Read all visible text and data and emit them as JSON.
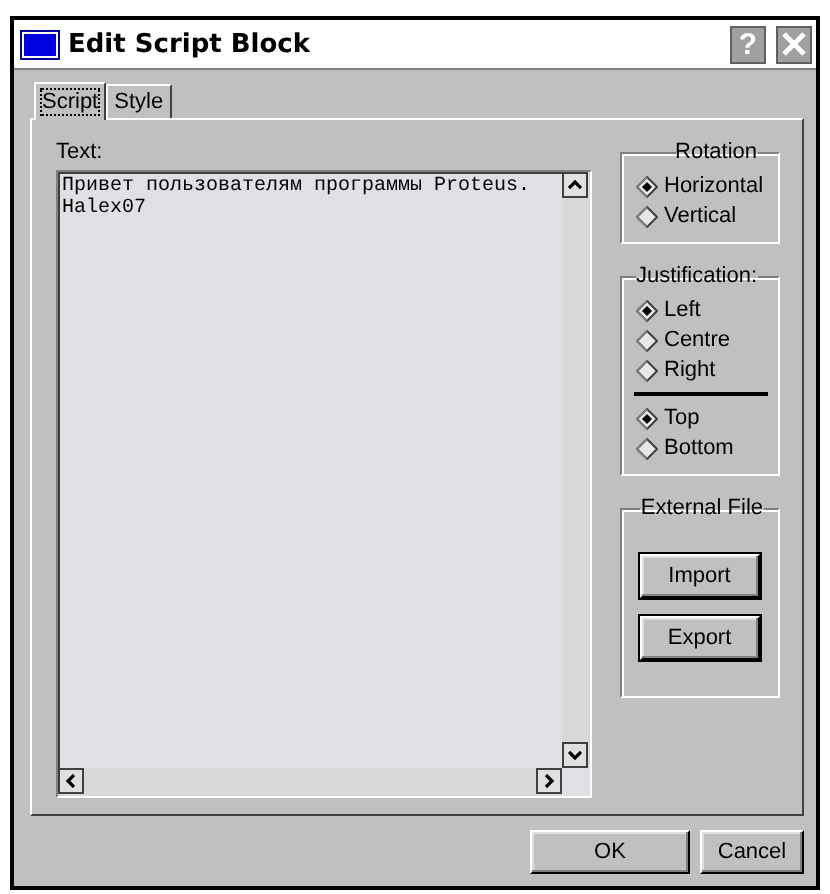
{
  "window": {
    "title": "Edit Script Block",
    "help": "?"
  },
  "tabs": [
    {
      "label": "Script",
      "selected": true
    },
    {
      "label": "Style",
      "selected": false
    }
  ],
  "text_label": "Text:",
  "text_value": "Привет пользователям программы Proteus.\nHalex07",
  "rotation": {
    "title": "Rotation",
    "options": [
      {
        "label": "Horizontal",
        "selected": true
      },
      {
        "label": "Vertical",
        "selected": false
      }
    ]
  },
  "justification": {
    "title": "Justification:",
    "horizontal": [
      {
        "label": "Left",
        "selected": true
      },
      {
        "label": "Centre",
        "selected": false
      },
      {
        "label": "Right",
        "selected": false
      }
    ],
    "vertical": [
      {
        "label": "Top",
        "selected": true
      },
      {
        "label": "Bottom",
        "selected": false
      }
    ]
  },
  "external_file": {
    "title": "External File",
    "buttons": [
      "Import",
      "Export"
    ]
  },
  "buttons": [
    "OK",
    "Cancel"
  ]
}
